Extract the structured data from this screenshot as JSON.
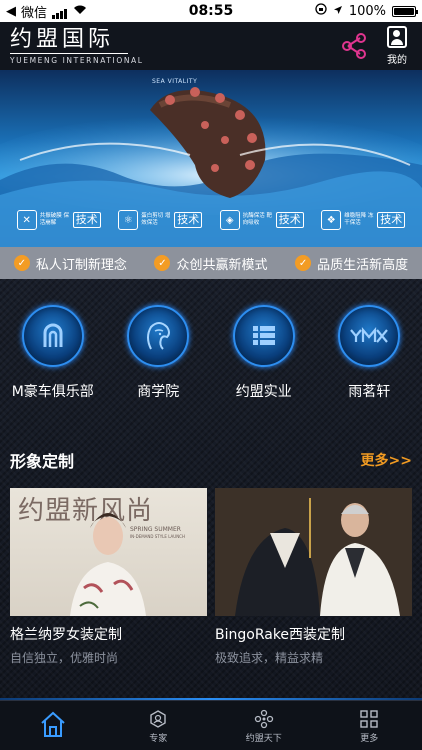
{
  "status_bar": {
    "carrier": "微信",
    "time": "08:55",
    "battery": "100%",
    "battery_level": 1.0
  },
  "header": {
    "logo_cn": "约盟国际",
    "logo_en": "YUEMENG INTERNATIONAL",
    "mine_label": "我的"
  },
  "banner": {
    "tag": "SEA VITALITY",
    "features": [
      {
        "small": "共振破膜 保活崩解",
        "big": "技术"
      },
      {
        "small": "蛋白剪切 增效保活",
        "big": "技术"
      },
      {
        "small": "抗酶保活 靶向吸收",
        "big": "技术"
      },
      {
        "small": "维稳阻降 冻干保活",
        "big": "技术"
      }
    ]
  },
  "slogans": [
    "私人订制新理念",
    "众创共赢新模式",
    "品质生活新高度"
  ],
  "categories": [
    {
      "label": "M豪车俱乐部",
      "icon": "car-club-icon"
    },
    {
      "label": "商学院",
      "icon": "woman-face-icon"
    },
    {
      "label": "约盟实业",
      "icon": "grid-building-icon"
    },
    {
      "label": "雨茗轩",
      "icon": "ymx-icon"
    }
  ],
  "section": {
    "title": "形象定制",
    "more": "更多>>"
  },
  "cards": [
    {
      "title": "格兰纳罗女装定制",
      "subtitle": "自信独立，优雅时尚",
      "img_text": "约盟新风尚",
      "img_small": "SPRING SUMMER",
      "img_small2": "IN-DEMAND STYLE LAUNCH"
    },
    {
      "title": "BingoRake西装定制",
      "subtitle": "极致追求，精益求精"
    }
  ],
  "tabbar": [
    {
      "label": "",
      "icon": "home-icon",
      "active": true
    },
    {
      "label": "专家",
      "icon": "expert-icon"
    },
    {
      "label": "约盟天下",
      "icon": "network-icon"
    },
    {
      "label": "更多",
      "icon": "apps-icon"
    }
  ],
  "colors": {
    "accent_orange": "#f09a22",
    "accent_blue": "#2d8ef0",
    "share_pink": "#e0358f",
    "slogan_bar": "#8d929c"
  }
}
